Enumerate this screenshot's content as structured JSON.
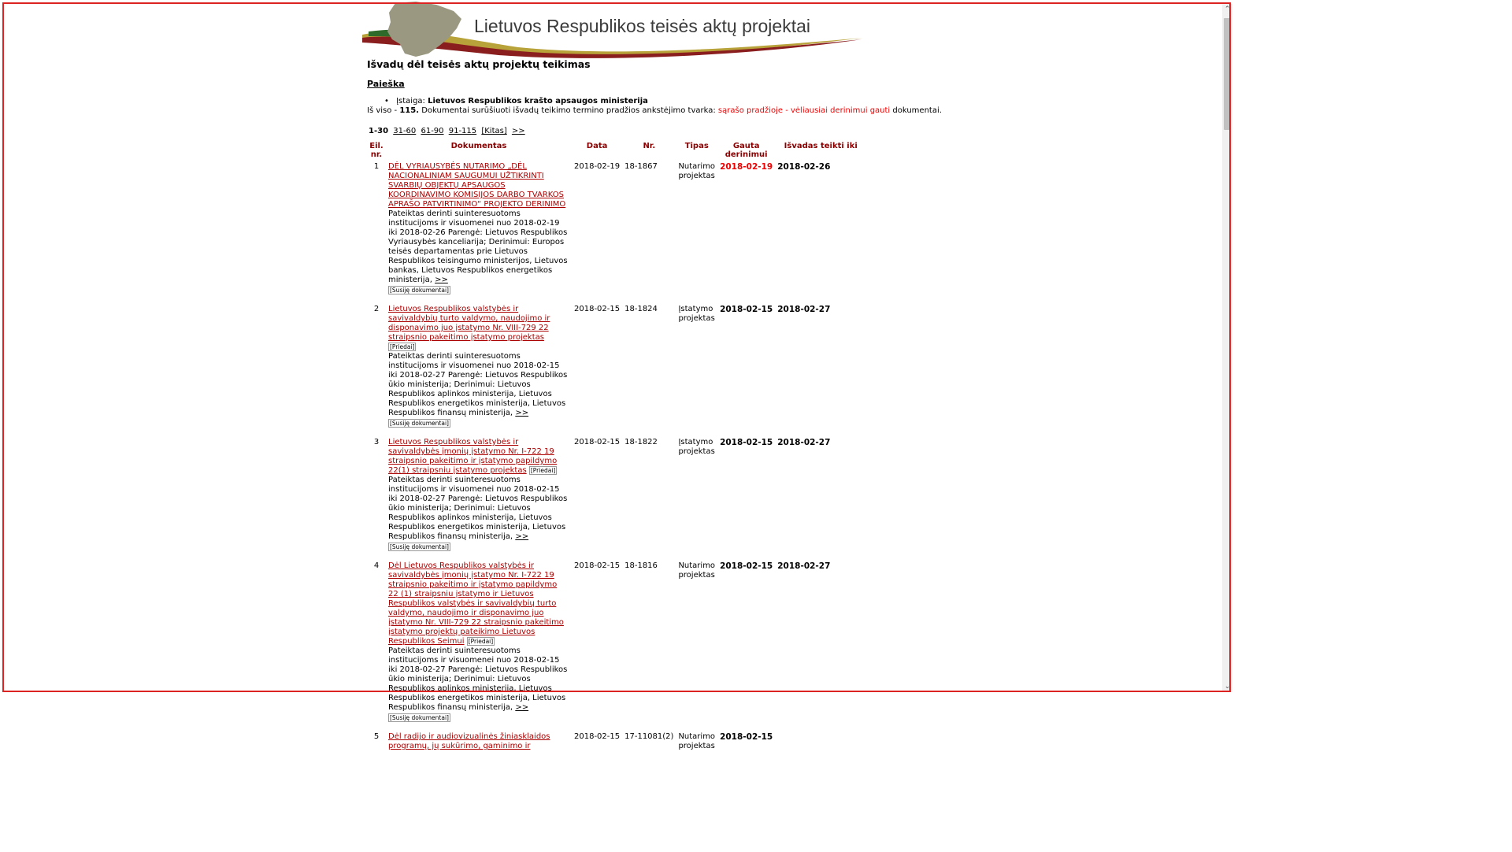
{
  "header": {
    "site_title": "Lietuvos Respublikos teisės aktų projektai"
  },
  "page": {
    "title": "Išvadų dėl teisės aktų projektų teikimas",
    "search_link": "Paieška",
    "filter_label": "Įstaiga:",
    "filter_value": "Lietuvos Respublikos krašto apsaugos ministerija",
    "summary_prefix": "Iš viso -",
    "summary_total": "115.",
    "summary_mid": "Dokumentai surūšiuoti išvadų teikimo termino pradžios ankstėjimo tvarka:",
    "summary_red": "sąrašo pradžioje - vėliausiai derinimui gauti",
    "summary_suffix": "dokumentai."
  },
  "pager": {
    "current": "1-30",
    "pages": [
      "31-60",
      "61-90",
      "91-115",
      "[Kitas]",
      ">>"
    ]
  },
  "table": {
    "headers": {
      "num": "Eil. nr.",
      "doc": "Dokumentas",
      "date": "Data",
      "nr": "Nr.",
      "type": "Tipas",
      "gauta": "Gauta derinimui",
      "iki": "Išvadas teikti iki"
    },
    "rows": [
      {
        "num": "1",
        "title": "DĖL VYRIAUSYBĖS NUTARIMO „DĖL NACIONALINIAM SAUGUMUI UŽTIKRINTI SVARBIŲ OBJEKTŲ APSAUGOS KOORDINAVIMO KOMISIJOS DARBO TVARKOS APRAŠO PATVIRTINIMO“ PROJEKTO DERINIMO",
        "attachments": "",
        "desc": "Pateiktas derinti suinteresuotoms institucijoms ir visuomenei nuo 2018-02-19 iki 2018-02-26 Parengė: Lietuvos Respublikos Vyriausybės kanceliarija; Derinimui: Europos teisės departamentas prie Lietuvos Respublikos teisingumo ministerijos, Lietuvos bankas, Lietuvos Respublikos energetikos ministerija,",
        "more": ">>",
        "related": "[Susiję dokumentai]",
        "date": "2018-02-19",
        "nr": "18-1867",
        "type": "Nutarimo projektas",
        "gauta": "2018-02-19",
        "iki": "2018-02-26"
      },
      {
        "num": "2",
        "title": "Lietuvos Respublikos valstybės ir savivaldybių turto valdymo, naudojimo ir disponavimo juo įstatymo Nr. VIII-729 22 straipsnio pakeitimo įstatymo projektas",
        "attachments": "[Priedai]",
        "desc": "Pateiktas derinti suinteresuotoms institucijoms ir visuomenei nuo 2018-02-15 iki 2018-02-27 Parengė: Lietuvos Respublikos ūkio ministerija; Derinimui: Lietuvos Respublikos aplinkos ministerija, Lietuvos Respublikos energetikos ministerija, Lietuvos Respublikos finansų ministerija,",
        "more": ">>",
        "related": "[Susiję dokumentai]",
        "date": "2018-02-15",
        "nr": "18-1824",
        "type": "Įstatymo projektas",
        "gauta": "2018-02-15",
        "iki": "2018-02-27"
      },
      {
        "num": "3",
        "title": "Lietuvos Respublikos valstybės ir savivaldybės įmonių įstatymo Nr. I-722 19 straipsnio pakeitimo ir įstatymo papildymo 22(1) straipsniu įstatymo projektas",
        "attachments": "[Priedai]",
        "desc": "Pateiktas derinti suinteresuotoms institucijoms ir visuomenei nuo 2018-02-15 iki 2018-02-27 Parengė: Lietuvos Respublikos ūkio ministerija; Derinimui: Lietuvos Respublikos aplinkos ministerija, Lietuvos Respublikos energetikos ministerija, Lietuvos Respublikos finansų ministerija,",
        "more": ">>",
        "related": "[Susiję dokumentai]",
        "date": "2018-02-15",
        "nr": "18-1822",
        "type": "Įstatymo projektas",
        "gauta": "2018-02-15",
        "iki": "2018-02-27"
      },
      {
        "num": "4",
        "title": "Dėl Lietuvos Respublikos valstybės ir savivaldybės įmonių įstatymo Nr. I-722 19 straipsnio pakeitimo ir įstatymo papildymo 22 (1) straipsniu įstatymo ir Lietuvos Respublikos valstybės ir savivaldybių turto valdymo, naudojimo ir disponavimo juo įstatymo Nr. VIII-729 22 straipsnio pakeitimo įstatymo projektų pateikimo Lietuvos Respublikos Seimui",
        "attachments": "[Priedai]",
        "desc": "Pateiktas derinti suinteresuotoms institucijoms ir visuomenei nuo 2018-02-15 iki 2018-02-27 Parengė: Lietuvos Respublikos ūkio ministerija; Derinimui: Lietuvos Respublikos aplinkos ministerija, Lietuvos Respublikos energetikos ministerija, Lietuvos Respublikos finansų ministerija,",
        "more": ">>",
        "related": "[Susiję dokumentai]",
        "date": "2018-02-15",
        "nr": "18-1816",
        "type": "Nutarimo projektas",
        "gauta": "2018-02-15",
        "iki": "2018-02-27"
      },
      {
        "num": "5",
        "title": "Dėl radijo ir audiovizualinės žiniasklaidos programų, jų sukūrimo, gaminimo ir",
        "attachments": "",
        "desc": "",
        "more": "",
        "related": "",
        "date": "2018-02-15",
        "nr": "17-11081(2)",
        "type": "Nutarimo projektas",
        "gauta": "2018-02-15",
        "iki": ""
      }
    ]
  },
  "colors": {
    "link": "#a00000",
    "header": "#8b0000",
    "highlight": "#e00000",
    "frame": "#dd2222"
  }
}
